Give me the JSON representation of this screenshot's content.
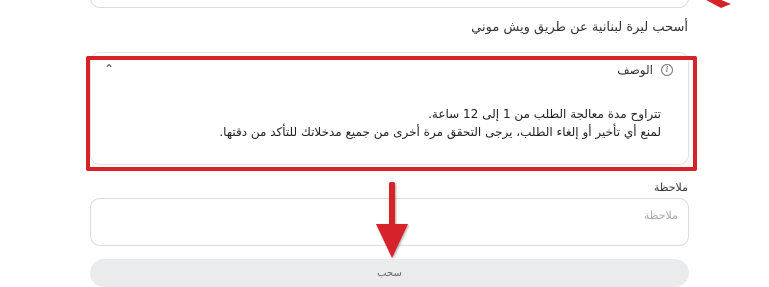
{
  "section_caption": "أسحب ليرة لبنانية عن طريق ويش موني",
  "description": {
    "title": "الوصف",
    "lines": [
      "تتراوح مدة معالجة الطلب من 1 إلى 12 ساعة.",
      "لمنع أي تأخير أو إلغاء الطلب، يرجى التحقق مرة أخرى من جميع مدخلاتك للتأكد من دقتها."
    ]
  },
  "note": {
    "label": "ملاحظة",
    "placeholder": "ملاحظة",
    "value": ""
  },
  "withdraw_button": {
    "label": "سحب"
  },
  "colors": {
    "highlight": "#d6232a",
    "button_bg": "#eaebed",
    "border": "#dcdcdc"
  },
  "icons": [
    "info-icon",
    "chevron-up-icon",
    "annotation-arrow-icon"
  ]
}
